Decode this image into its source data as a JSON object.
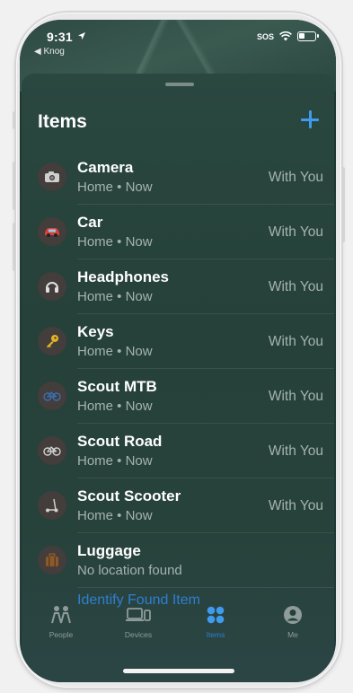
{
  "status_bar": {
    "time": "9:31",
    "back_label": "◀ Knog",
    "sos": "SOS"
  },
  "sheet": {
    "title": "Items"
  },
  "items": [
    {
      "name": "Camera",
      "subtitle": "Home • Now",
      "status": "With You",
      "icon": "camera-icon"
    },
    {
      "name": "Car",
      "subtitle": "Home • Now",
      "status": "With You",
      "icon": "car-icon"
    },
    {
      "name": "Headphones",
      "subtitle": "Home • Now",
      "status": "With You",
      "icon": "headphones-icon"
    },
    {
      "name": "Keys",
      "subtitle": "Home • Now",
      "status": "With You",
      "icon": "key-icon"
    },
    {
      "name": "Scout MTB",
      "subtitle": "Home • Now",
      "status": "With You",
      "icon": "bicycle-icon"
    },
    {
      "name": "Scout Road",
      "subtitle": "Home • Now",
      "status": "With You",
      "icon": "bicycle-icon"
    },
    {
      "name": "Scout Scooter",
      "subtitle": "Home • Now",
      "status": "With You",
      "icon": "scooter-icon"
    },
    {
      "name": "Luggage",
      "subtitle": "No location found",
      "status": "",
      "icon": "luggage-icon"
    }
  ],
  "identify_link": "Identify Found Item",
  "tabs": [
    {
      "label": "People",
      "icon": "people-icon"
    },
    {
      "label": "Devices",
      "icon": "devices-icon"
    },
    {
      "label": "Items",
      "icon": "items-icon",
      "active": true
    },
    {
      "label": "Me",
      "icon": "me-icon"
    }
  ],
  "colors": {
    "accent": "#3f9bf0",
    "link": "#2e7fcf",
    "background": "#23403a"
  }
}
